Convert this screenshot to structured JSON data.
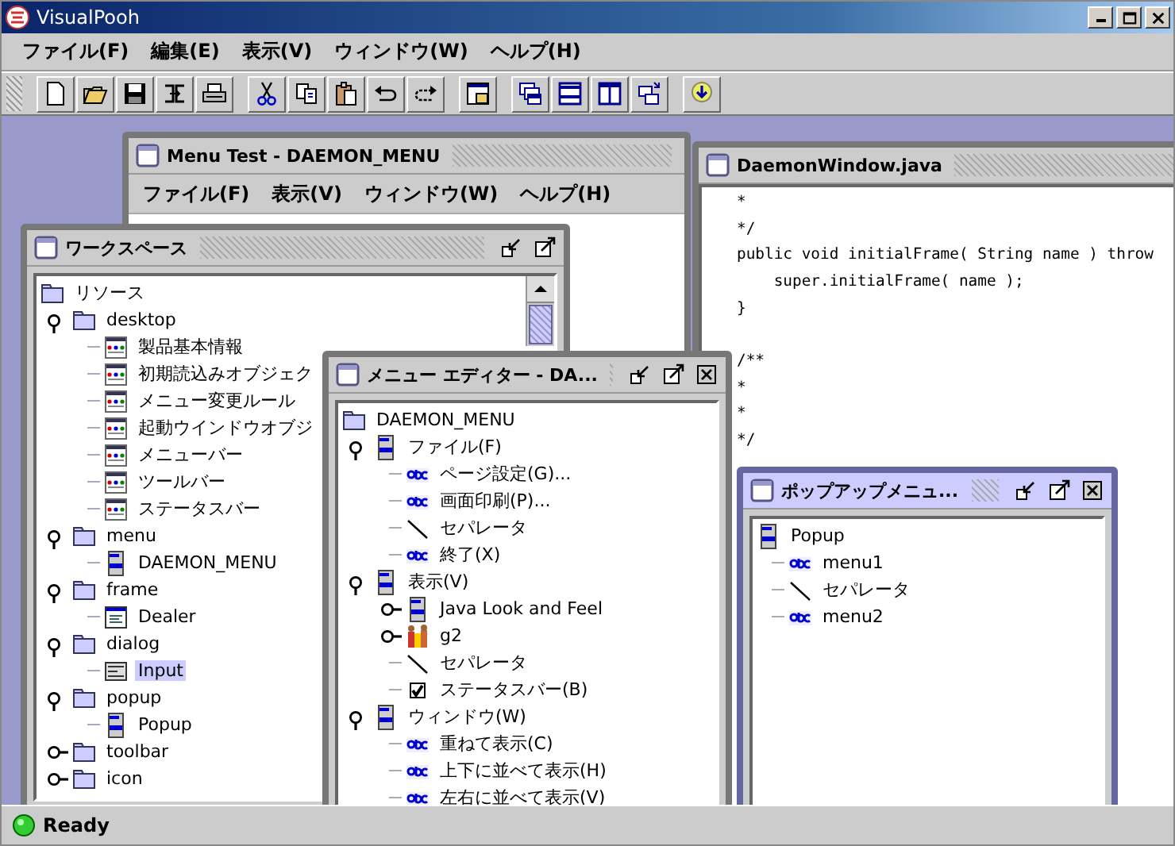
{
  "window": {
    "title": "VisualPooh"
  },
  "menu_bar": [
    "ファイル(F)",
    "編集(E)",
    "表示(V)",
    "ウィンドウ(W)",
    "ヘルプ(H)"
  ],
  "toolbar": [
    [
      {
        "kind": "new"
      },
      {
        "kind": "open"
      },
      {
        "kind": "save"
      },
      {
        "kind": "convert"
      },
      {
        "kind": "print"
      }
    ],
    [
      {
        "kind": "cut"
      },
      {
        "kind": "copy"
      },
      {
        "kind": "paste"
      },
      {
        "kind": "undo"
      },
      {
        "kind": "redo"
      }
    ],
    [
      {
        "kind": "window"
      }
    ],
    [
      {
        "kind": "cascade"
      },
      {
        "kind": "tile_h"
      },
      {
        "kind": "tile_v"
      },
      {
        "kind": "arrange"
      }
    ],
    [
      {
        "kind": "run"
      }
    ]
  ],
  "internal_windows": [
    {
      "kind": "menu_test",
      "title": "Menu Test - DAEMON_MENU",
      "active": false,
      "menu": [
        "ファイル(F)",
        "表示(V)",
        "ウィンドウ(W)",
        "ヘルプ(H)"
      ]
    },
    {
      "kind": "code",
      "title": "DaemonWindow.java",
      "active": false,
      "blocks": [
        [
          "*",
          "*/",
          "public void initialFrame( String name ) throw",
          "    super.initialFrame( name );",
          "}"
        ],
        [
          "/**",
          "*",
          "*",
          "*/"
        ]
      ]
    },
    {
      "kind": "tree",
      "title": "ワークスペース",
      "active": false,
      "controls": [
        {
          "kind": "iconify"
        },
        {
          "kind": "maximize"
        }
      ],
      "tree": [
        {
          "label": "リソース",
          "kind": "folder",
          "selected": false,
          "children": [
            {
              "label": "desktop",
              "kind": "folder",
              "expanded": true,
              "selected": false,
              "children": [
                {
                  "label": "製品基本情報",
                  "kind": "form",
                  "selected": false
                },
                {
                  "label": "初期読込みオブジェク",
                  "kind": "form",
                  "selected": false
                },
                {
                  "label": "メニュー変更ルール",
                  "kind": "form",
                  "selected": false
                },
                {
                  "label": "起動ウインドウオブジ",
                  "kind": "form",
                  "selected": false
                },
                {
                  "label": "メニューバー",
                  "kind": "form",
                  "selected": false
                },
                {
                  "label": "ツールバー",
                  "kind": "form",
                  "selected": false
                },
                {
                  "label": "ステータスバー",
                  "kind": "form",
                  "selected": false
                }
              ]
            },
            {
              "label": "menu",
              "kind": "folder",
              "expanded": true,
              "selected": false,
              "children": [
                {
                  "label": "DAEMON_MENU",
                  "kind": "menu",
                  "selected": false
                }
              ]
            },
            {
              "label": "frame",
              "kind": "folder",
              "expanded": true,
              "selected": false,
              "children": [
                {
                  "label": "Dealer",
                  "kind": "frame",
                  "selected": false
                }
              ]
            },
            {
              "label": "dialog",
              "kind": "folder",
              "expanded": true,
              "selected": false,
              "children": [
                {
                  "label": "Input",
                  "kind": "dialog",
                  "selected": true
                }
              ]
            },
            {
              "label": "popup",
              "kind": "folder",
              "expanded": true,
              "selected": false,
              "children": [
                {
                  "label": "Popup",
                  "kind": "menu",
                  "selected": false
                }
              ]
            },
            {
              "label": "toolbar",
              "kind": "folder",
              "expanded": false,
              "selected": false
            },
            {
              "label": "icon",
              "kind": "folder",
              "expanded": false,
              "selected": false
            }
          ]
        }
      ]
    },
    {
      "kind": "tree",
      "title": "メニュー エディター - DA...",
      "active": false,
      "controls": [
        {
          "kind": "iconify"
        },
        {
          "kind": "maximize"
        },
        {
          "kind": "close"
        }
      ],
      "tree": [
        {
          "label": "DAEMON_MENU",
          "kind": "folder",
          "selected": false,
          "children": [
            {
              "label": "ファイル(F)",
              "kind": "menu",
              "expanded": true,
              "selected": false,
              "children": [
                {
                  "label": "ページ設定(G)...",
                  "kind": "item",
                  "selected": false
                },
                {
                  "label": "画面印刷(P)...",
                  "kind": "item",
                  "selected": false
                },
                {
                  "label": "セパレータ",
                  "kind": "separator",
                  "selected": false
                },
                {
                  "label": "終了(X)",
                  "kind": "item",
                  "selected": false
                }
              ]
            },
            {
              "label": "表示(V)",
              "kind": "menu",
              "expanded": true,
              "selected": false,
              "children": [
                {
                  "label": "Java Look and Feel",
                  "kind": "menu",
                  "expanded": false,
                  "selected": false
                },
                {
                  "label": "g2",
                  "kind": "group",
                  "expanded": false,
                  "selected": false
                },
                {
                  "label": "セパレータ",
                  "kind": "separator",
                  "selected": false
                },
                {
                  "label": "ステータスバー(B)",
                  "kind": "check",
                  "checked": true,
                  "selected": false
                }
              ]
            },
            {
              "label": "ウィンドウ(W)",
              "kind": "menu",
              "expanded": true,
              "selected": false,
              "children": [
                {
                  "label": "重ねて表示(C)",
                  "kind": "item",
                  "selected": false
                },
                {
                  "label": "上下に並べて表示(H)",
                  "kind": "item",
                  "selected": false
                },
                {
                  "label": "左右に並べて表示(V)",
                  "kind": "item",
                  "selected": false
                }
              ]
            }
          ]
        }
      ]
    },
    {
      "kind": "tree",
      "title": "ポップアップメニュ...",
      "active": true,
      "controls": [
        {
          "kind": "iconify"
        },
        {
          "kind": "maximize"
        },
        {
          "kind": "close"
        }
      ],
      "tree": [
        {
          "label": "Popup",
          "kind": "menu",
          "selected": false,
          "children": [
            {
              "label": "menu1",
              "kind": "item",
              "selected": false
            },
            {
              "label": "セパレータ",
              "kind": "separator",
              "selected": false
            },
            {
              "label": "menu2",
              "kind": "item",
              "selected": false
            }
          ]
        }
      ]
    }
  ],
  "status_bar": {
    "text": "Ready"
  }
}
